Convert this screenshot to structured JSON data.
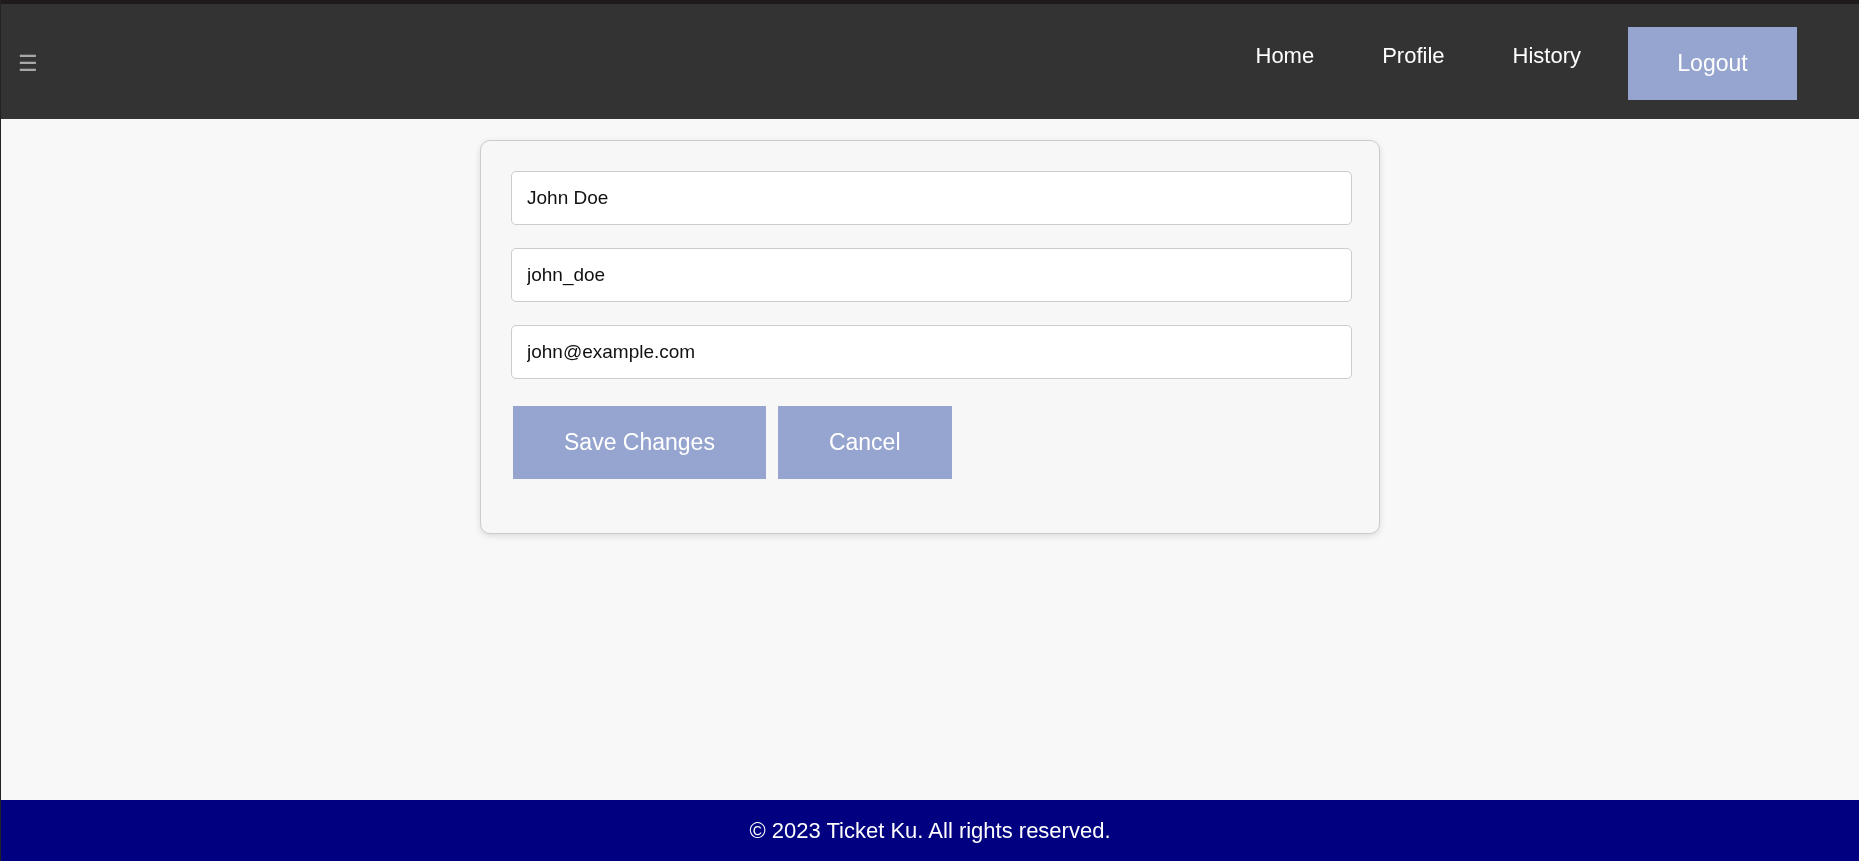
{
  "header": {
    "menu_icon": "☰",
    "nav": [
      {
        "label": "Home"
      },
      {
        "label": "Profile"
      },
      {
        "label": "History"
      }
    ],
    "logout": "Logout"
  },
  "form": {
    "fields": [
      {
        "value": "John Doe"
      },
      {
        "value": "john_doe"
      },
      {
        "value": "john@example.com"
      }
    ],
    "buttons": [
      "Save Changes",
      "Cancel"
    ]
  },
  "footer": {
    "text": "© 2023 Ticket Ku. All rights reserved."
  }
}
